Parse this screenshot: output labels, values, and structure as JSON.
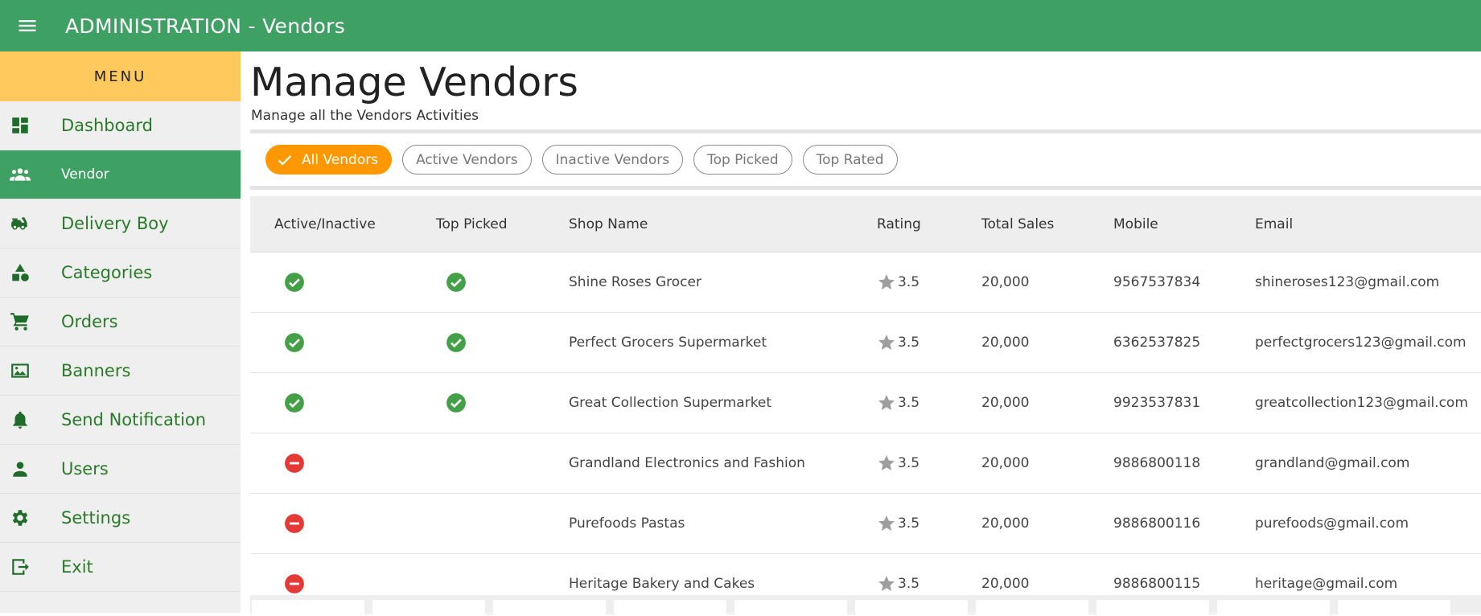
{
  "header": {
    "title": "ADMINISTRATION - Vendors",
    "menu_icon": "hamburger-menu-icon",
    "bg_color": "#3fa064"
  },
  "sidebar": {
    "menu_label": "MENU",
    "menu_bg": "#ffc95e",
    "items": [
      {
        "label": "Dashboard",
        "icon": "dashboard-icon"
      },
      {
        "label": "Vendor",
        "icon": "people-icon",
        "active": true
      },
      {
        "label": "Delivery Boy",
        "icon": "delivery-scooter-icon"
      },
      {
        "label": "Categories",
        "icon": "categories-shapes-icon"
      },
      {
        "label": "Orders",
        "icon": "cart-icon"
      },
      {
        "label": "Banners",
        "icon": "image-icon"
      },
      {
        "label": "Send Notification",
        "icon": "bell-icon"
      },
      {
        "label": "Users",
        "icon": "person-icon"
      },
      {
        "label": "Settings",
        "icon": "gear-icon"
      },
      {
        "label": "Exit",
        "icon": "exit-icon"
      }
    ]
  },
  "main": {
    "title": "Manage Vendors",
    "subtitle": "Manage all the Vendors Activities",
    "filters": [
      {
        "label": "All Vendors",
        "selected": true
      },
      {
        "label": "Active Vendors"
      },
      {
        "label": "Inactive Vendors"
      },
      {
        "label": "Top Picked"
      },
      {
        "label": "Top Rated"
      }
    ],
    "table": {
      "columns": [
        "Active/Inactive",
        "Top Picked",
        "Shop Name",
        "Rating",
        "Total Sales",
        "Mobile",
        "Email"
      ],
      "rows": [
        {
          "active": true,
          "top_picked": true,
          "shop": "Shine Roses Grocer",
          "rating": "3.5",
          "sales": "20,000",
          "mobile": "9567537834",
          "email": "shineroses123@gmail.com"
        },
        {
          "active": true,
          "top_picked": true,
          "shop": "Perfect Grocers Supermarket",
          "rating": "3.5",
          "sales": "20,000",
          "mobile": "6362537825",
          "email": "perfectgrocers123@gmail.com"
        },
        {
          "active": true,
          "top_picked": true,
          "shop": "Great Collection Supermarket",
          "rating": "3.5",
          "sales": "20,000",
          "mobile": "9923537831",
          "email": "greatcollection123@gmail.com"
        },
        {
          "active": false,
          "top_picked": false,
          "shop": "Grandland Electronics and Fashion",
          "rating": "3.5",
          "sales": "20,000",
          "mobile": "9886800118",
          "email": "grandland@gmail.com"
        },
        {
          "active": false,
          "top_picked": false,
          "shop": "Purefoods Pastas",
          "rating": "3.5",
          "sales": "20,000",
          "mobile": "9886800116",
          "email": "purefoods@gmail.com"
        },
        {
          "active": false,
          "top_picked": false,
          "shop": "Heritage Bakery and Cakes",
          "rating": "3.5",
          "sales": "20,000",
          "mobile": "9886800115",
          "email": "heritage@gmail.com"
        }
      ]
    },
    "colors": {
      "active": "#43a047",
      "inactive": "#e53935",
      "chip_selected": "#ff9800",
      "star": "#9e9e9e"
    }
  }
}
